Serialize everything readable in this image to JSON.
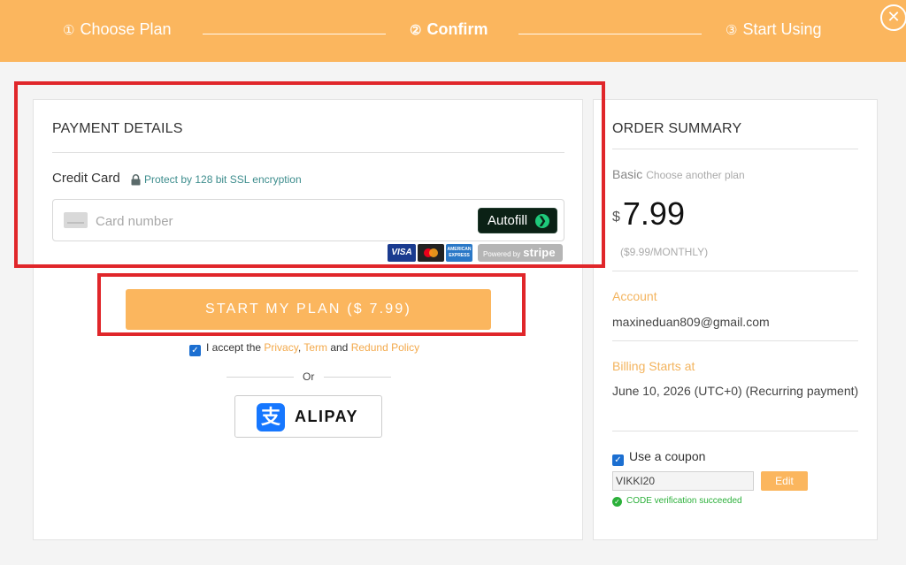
{
  "stepper": {
    "step1_num": "①",
    "step1_label": "Choose Plan",
    "step2_num": "②",
    "step2_label": "Confirm",
    "step3_num": "③",
    "step3_label": "Start Using",
    "close": "✕"
  },
  "payment": {
    "title": "PAYMENT DETAILS",
    "credit_card_label": "Credit Card",
    "ssl_text": "Protect by 128 bit SSL encryption",
    "card_placeholder": "Card number",
    "card_value": "",
    "autofill_label": "Autofill",
    "logos": {
      "visa": "VISA",
      "amex": "AMERICAN EXPRESS",
      "powered_by": "Powered by",
      "stripe": "stripe"
    },
    "start_button": "START MY PLAN ($ 7.99)",
    "accept_prefix": "I accept the",
    "privacy_link": "Privacy",
    "comma": ",",
    "term_link": "Term",
    "and_text": "and",
    "refund_link": "Redund Policy",
    "or_text": "Or",
    "alipay_icon_glyph": "支",
    "alipay_label": "ALIPAY"
  },
  "order": {
    "title": "ORDER SUMMARY",
    "plan_name": "Basic",
    "choose_another": "Choose another plan",
    "currency": "$",
    "price": "7.99",
    "original_price": "($9.99/MONTHLY)",
    "account_label": "Account",
    "account_email": "maxineduan809@gmail.com",
    "billing_label": "Billing Starts at",
    "billing_value": "June 10, 2026 (UTC+0) (Recurring payment)",
    "coupon_label": "Use a coupon",
    "coupon_checked": true,
    "coupon_code": "VIKKI20",
    "edit_label": "Edit",
    "verify_text": "CODE verification succeeded"
  },
  "colors": {
    "brand_orange": "#fbb65e",
    "link_orange": "#f3a94b",
    "success_green": "#2bb03a",
    "annotation_red": "#e0262a",
    "checkbox_blue": "#1c6fd1"
  }
}
